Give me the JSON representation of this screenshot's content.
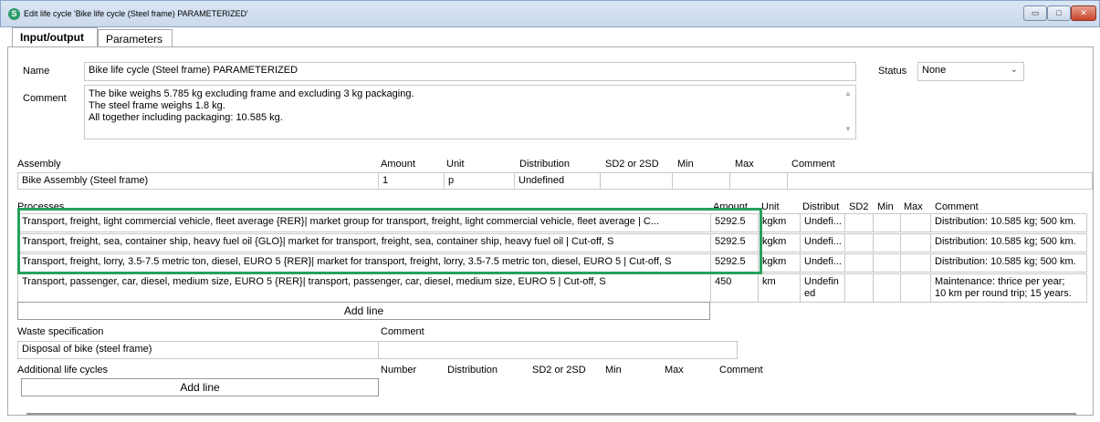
{
  "window": {
    "title": "Edit life cycle 'Bike life cycle (Steel frame) PARAMETERIZED'",
    "app_icon": "S",
    "min_glyph": "▭",
    "max_glyph": "□",
    "close_glyph": "✕"
  },
  "tabs": [
    {
      "label": "Input/output",
      "active": true
    },
    {
      "label": "Parameters",
      "active": false
    }
  ],
  "form": {
    "name_label": "Name",
    "name_value": "Bike life cycle (Steel frame) PARAMETERIZED",
    "status_label": "Status",
    "status_value": "None",
    "comment_label": "Comment",
    "comment_lines": [
      "The bike weighs 5.785 kg excluding frame and excluding 3 kg packaging.",
      "The steel frame weighs 1.8 kg.",
      "All together including packaging: 10.585 kg."
    ]
  },
  "assembly": {
    "headers": [
      "Assembly",
      "Amount",
      "Unit",
      "Distribution",
      "SD2 or 2SD",
      "Min",
      "Max",
      "Comment"
    ],
    "row": {
      "name": "Bike Assembly (Steel frame)",
      "amount": "1",
      "unit": "p",
      "distribution": "Undefined",
      "sd": "",
      "min": "",
      "max": "",
      "comment": ""
    }
  },
  "processes": {
    "headers": [
      "Processes",
      "Amount",
      "Unit",
      "Distribut",
      "SD2",
      "Min",
      "Max",
      "Comment"
    ],
    "rows": [
      {
        "name": "Transport, freight, light commercial vehicle, fleet average {RER}| market group for transport, freight, light commercial vehicle, fleet average | C...",
        "amount": "5292.5",
        "unit": "kgkm",
        "distribution": "Undefi...",
        "comment": "Distribution: 10.585 kg; 500 km."
      },
      {
        "name": "Transport, freight, sea, container ship, heavy fuel oil {GLO}| market for transport, freight, sea, container ship, heavy fuel oil | Cut-off, S",
        "amount": "5292.5",
        "unit": "kgkm",
        "distribution": "Undefi...",
        "comment": "Distribution: 10.585 kg; 500 km."
      },
      {
        "name": "Transport, freight, lorry, 3.5-7.5 metric ton, diesel, EURO 5 {RER}| market for transport, freight, lorry, 3.5-7.5 metric ton, diesel, EURO 5 | Cut-off, S",
        "amount": "5292.5",
        "unit": "kgkm",
        "distribution": "Undefi...",
        "comment": "Distribution: 10.585 kg; 500 km."
      },
      {
        "name": "Transport, passenger, car, diesel, medium size, EURO 5 {RER}| transport, passenger, car, diesel, medium size, EURO 5 | Cut-off, S",
        "amount": "450",
        "unit": "km",
        "distribution_l1": "Undefin",
        "distribution_l2": "ed",
        "comment_l1": "Maintenance: thrice per year;",
        "comment_l2": "10 km per round trip; 15 years."
      }
    ],
    "add_line": "Add line"
  },
  "waste": {
    "headers": [
      "Waste specification",
      "Comment"
    ],
    "row": {
      "name": "Disposal of bike (steel frame)",
      "comment": ""
    }
  },
  "additional": {
    "headers": [
      "Additional life cycles",
      "Number",
      "Distribution",
      "SD2 or 2SD",
      "Min",
      "Max",
      "Comment"
    ],
    "add_line": "Add line"
  },
  "colors": {
    "highlight": "#27a15c",
    "close_button": "#c8442c"
  }
}
